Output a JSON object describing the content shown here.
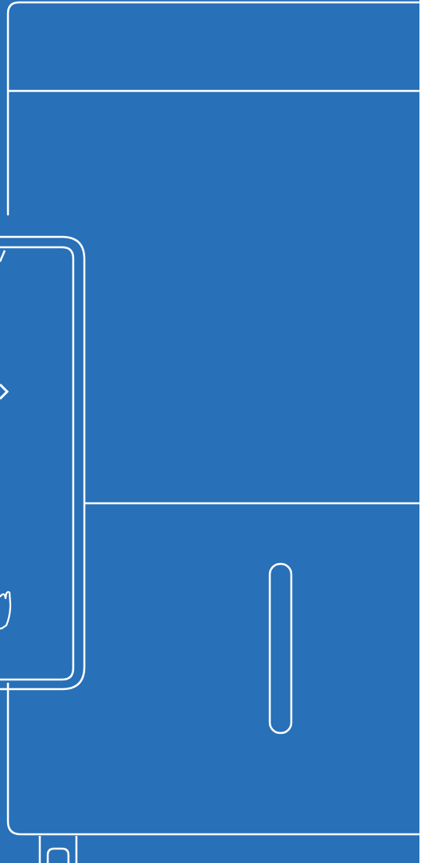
{
  "colors": {
    "background": "#2870b7",
    "line": "#ffffff",
    "page": "#ffffff"
  },
  "illustration": {
    "subject": "appliance-outline",
    "icons": [
      "chevron-right-icon",
      "hand-icon"
    ]
  }
}
